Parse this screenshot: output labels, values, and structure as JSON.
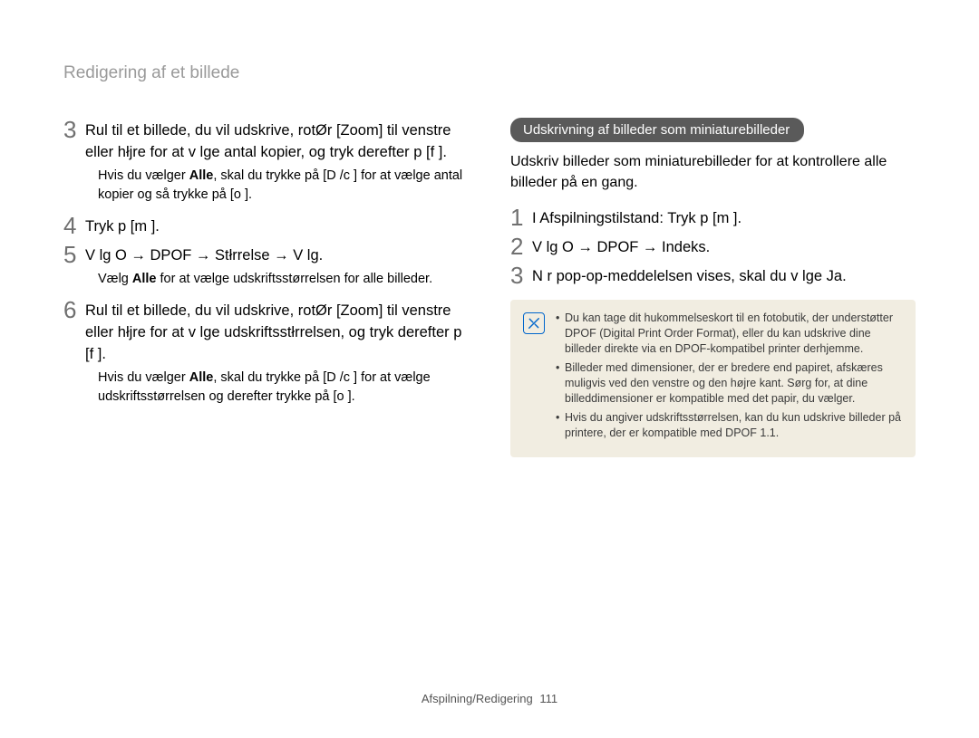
{
  "page_title": "Redigering af et billede",
  "left": {
    "step3": {
      "num": "3",
      "text": "Rul til et billede, du vil udskrive, rotØr [Zoom] til venstre eller hłjre for at v lge antal kopier, og tryk derefter p  [f     ].",
      "sub_before": "Hvis du vælger ",
      "sub_bold1": "Alle",
      "sub_mid": ", skal du trykke på [D       /c   ] for at vælge antal kopier og så trykke på [o     ]."
    },
    "step4": {
      "num": "4",
      "text": "Tryk p  [m       ]."
    },
    "step5": {
      "num": "5",
      "text": "V lg   O     → DPOF → Stłrrelse → V lg.",
      "sub_before": "Vælg ",
      "sub_bold1": "Alle",
      "sub_after": " for at vælge udskriftsstørrelsen for alle billeder."
    },
    "step6": {
      "num": "6",
      "text": "Rul til et billede, du vil udskrive, rotØr [Zoom] til venstre eller hłjre for at v lge udskriftsstłrrelsen, og tryk derefter p  [f     ].",
      "sub_before": "Hvis du vælger ",
      "sub_bold1": "Alle",
      "sub_mid": ", skal du trykke på [D       /c   ] for at vælge udskriftsstørrelsen og derefter trykke på [o     ]."
    }
  },
  "right": {
    "pill": "Udskrivning af billeder som miniaturebilleder",
    "intro": "Udskriv billeder som miniaturebilleder for at kontrollere alle billeder på en gang.",
    "step1": {
      "num": "1",
      "text": "I Afspilningstilstand: Tryk p  [m       ]."
    },
    "step2": {
      "num": "2",
      "text": "V lg   O     → DPOF → Indeks."
    },
    "step3": {
      "num": "3",
      "text": "N r pop-op-meddelelsen vises, skal du v lge Ja."
    },
    "notes": [
      "Du kan tage dit hukommelseskort til en fotobutik, der understøtter DPOF (Digital Print Order Format), eller du kan udskrive dine billeder direkte via en DPOF-kompatibel printer derhjemme.",
      "Billeder med dimensioner, der er bredere end papiret, afskæres muligvis ved den venstre og den højre kant. Sørg for, at dine billeddimensioner er kompatible med det papir, du vælger.",
      "Hvis du angiver udskriftsstørrelsen, kan du kun udskrive billeder på printere, der er kompatible med DPOF 1.1."
    ]
  },
  "footer": {
    "section": "Afspilning/Redigering",
    "page": "111"
  }
}
